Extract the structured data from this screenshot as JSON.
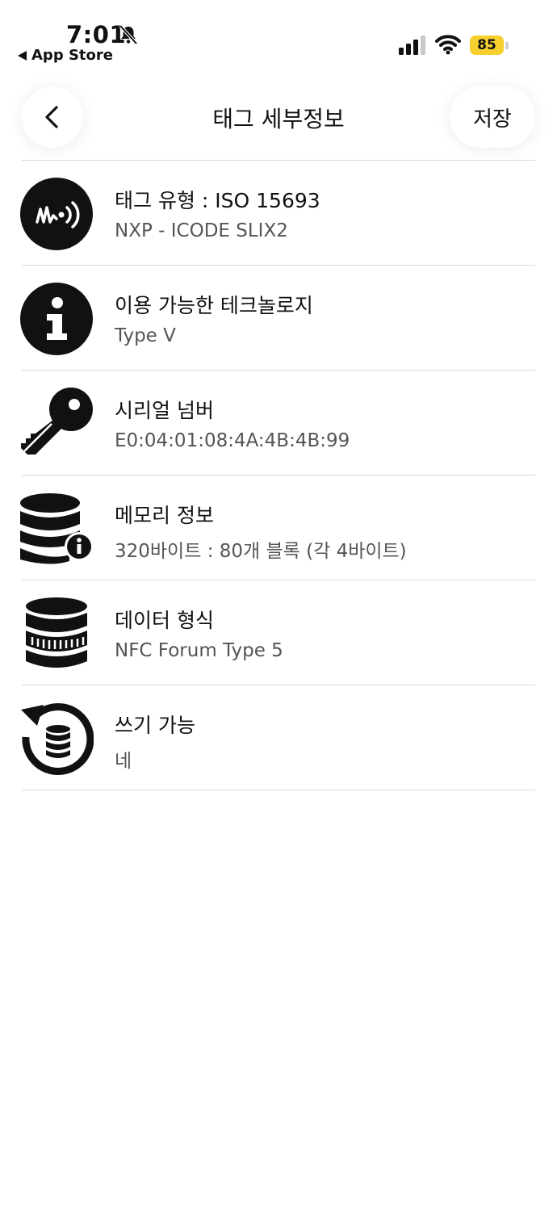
{
  "status_bar": {
    "time": "7:01",
    "back_app": "App Store",
    "battery": "85",
    "battery_color": "#f7cf2f"
  },
  "nav": {
    "title": "태그 세부정보",
    "save_label": "저장",
    "back_icon": "chevron-left-icon"
  },
  "rows": [
    {
      "icon": "nfc-tag-icon",
      "title": "태그 유형 : ISO 15693",
      "value": "NXP - ICODE SLIX2"
    },
    {
      "icon": "info-icon",
      "title": "이용 가능한 테크놀로지",
      "value": "Type V"
    },
    {
      "icon": "key-icon",
      "title": "시리얼 넘버",
      "value": "E0:04:01:08:4A:4B:4B:99"
    },
    {
      "icon": "database-info-icon",
      "title": "메모리 정보",
      "value": "320바이트 : 80개 블록 (각 4바이트)"
    },
    {
      "icon": "database-format-icon",
      "title": "데이터 형식",
      "value": "NFC Forum Type 5"
    },
    {
      "icon": "database-rewrite-icon",
      "title": "쓰기 가능",
      "value": "네"
    }
  ]
}
